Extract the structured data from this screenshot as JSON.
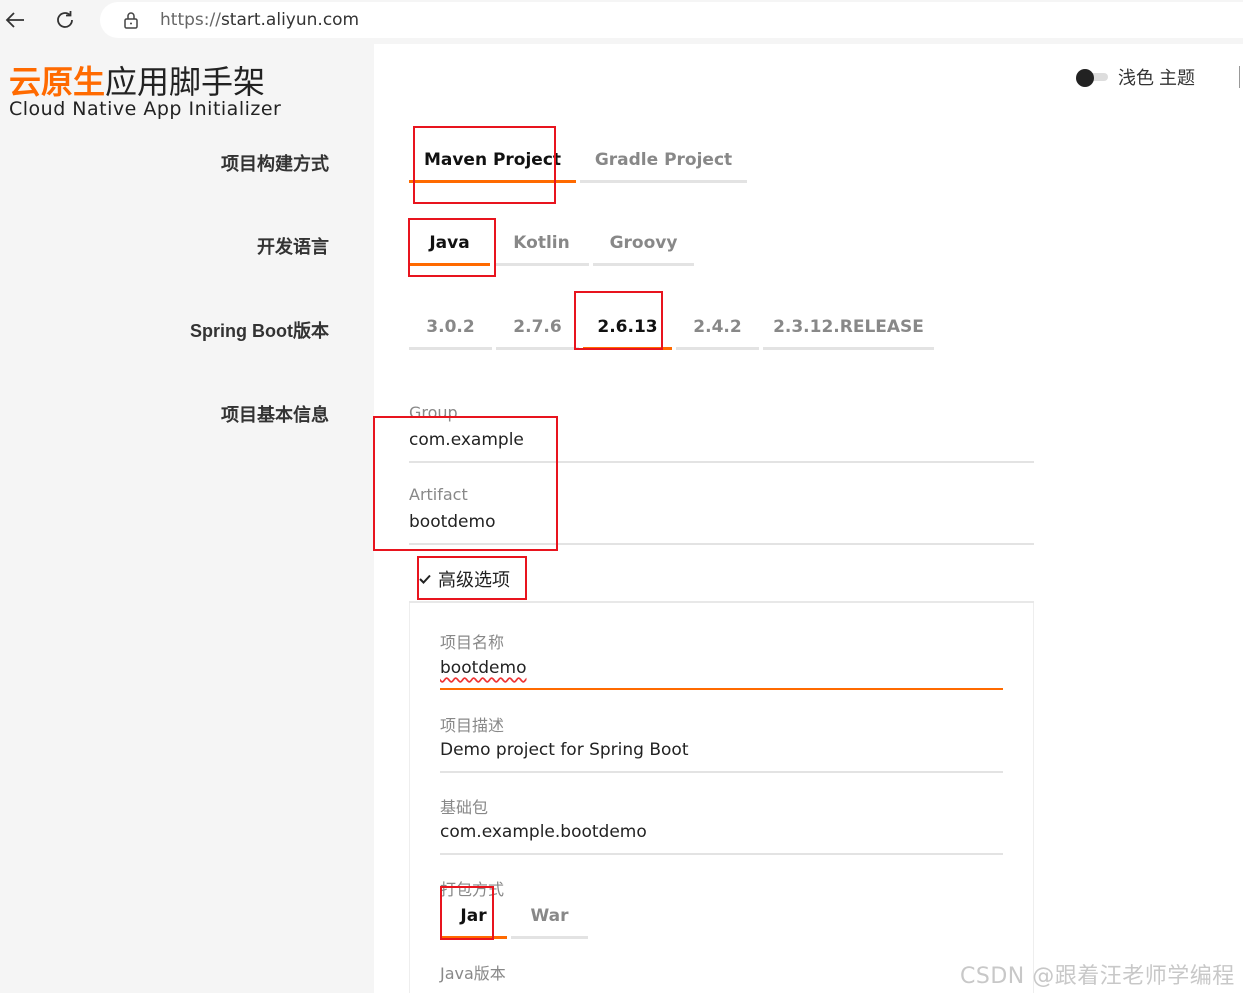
{
  "browser": {
    "url_scheme": "https://",
    "url_host": "start.aliyun.com"
  },
  "logo": {
    "cn_accent": "云原生",
    "cn_rest": "应用脚手架",
    "en": "Cloud Native App Initializer"
  },
  "theme": {
    "label": "浅色 主题"
  },
  "sections": {
    "build": "项目构建方式",
    "language": "开发语言",
    "boot_version": "Spring Boot版本",
    "basic_info": "项目基本信息"
  },
  "build_tabs": [
    "Maven Project",
    "Gradle Project"
  ],
  "language_tabs": [
    "Java",
    "Kotlin",
    "Groovy"
  ],
  "boot_tabs": [
    "3.0.2",
    "2.7.6",
    "2.6.13",
    "2.4.2",
    "2.3.12.RELEASE"
  ],
  "basic": {
    "group_label": "Group",
    "group_value": "com.example",
    "artifact_label": "Artifact",
    "artifact_value": "bootdemo"
  },
  "advanced": {
    "toggle_label": "高级选项",
    "name_label": "项目名称",
    "name_value": "bootdemo",
    "desc_label": "项目描述",
    "desc_value": "Demo project for Spring Boot",
    "package_label": "基础包",
    "package_value": "com.example.bootdemo",
    "packaging_label": "打包方式",
    "packaging_tabs": [
      "Jar",
      "War"
    ],
    "java_label": "Java版本"
  },
  "watermark": "CSDN @跟着汪老师学编程",
  "colors": {
    "accent": "#ff6a00",
    "highlight_box": "#e8141e"
  }
}
